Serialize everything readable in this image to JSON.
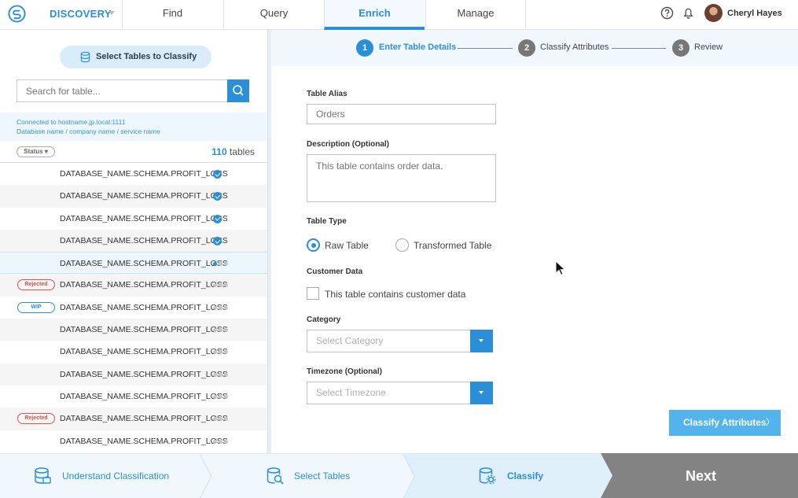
{
  "app": {
    "brand": "DISCOVERY",
    "user_name": "Cheryl Hayes",
    "tabs": [
      "Find",
      "Query",
      "Enrich",
      "Manage"
    ],
    "active_tab": "Enrich",
    "accent_color": "#2a8fd6"
  },
  "sidebar": {
    "select_button": "Select Tables to Classify",
    "search_placeholder": "Search for table...",
    "connection_line1": "Connected to hostname.jp.local:1111",
    "connection_line2": "Database name / company name / service name",
    "status_filter": "Status ▾",
    "table_count": "110",
    "table_count_label": "tables",
    "rows": [
      {
        "name": "DATABASE_NAME.SCHEMA.PROFIT_LOSS",
        "state": "done",
        "tag": ""
      },
      {
        "name": "DATABASE_NAME.SCHEMA.PROFIT_LOSS",
        "state": "done",
        "tag": ""
      },
      {
        "name": "DATABASE_NAME.SCHEMA.PROFIT_LOSS",
        "state": "done",
        "tag": ""
      },
      {
        "name": "DATABASE_NAME.SCHEMA.PROFIT_LOSS",
        "state": "done",
        "tag": ""
      },
      {
        "name": "DATABASE_NAME.SCHEMA.PROFIT_LOSS",
        "state": "in-progress",
        "tag": ""
      },
      {
        "name": "DATABASE_NAME.SCHEMA.PROFIT_LOSS",
        "state": "pending",
        "tag": "Rejected"
      },
      {
        "name": "DATABASE_NAME.SCHEMA.PROFIT_LOSS",
        "state": "pending",
        "tag": "WIP"
      },
      {
        "name": "DATABASE_NAME.SCHEMA.PROFIT_LOSS",
        "state": "pending",
        "tag": ""
      },
      {
        "name": "DATABASE_NAME.SCHEMA.PROFIT_LOSS",
        "state": "pending",
        "tag": ""
      },
      {
        "name": "DATABASE_NAME.SCHEMA.PROFIT_LOSS",
        "state": "pending",
        "tag": ""
      },
      {
        "name": "DATABASE_NAME.SCHEMA.PROFIT_LOSS",
        "state": "pending",
        "tag": ""
      },
      {
        "name": "DATABASE_NAME.SCHEMA.PROFIT_LOSS",
        "state": "pending",
        "tag": "Rejected"
      },
      {
        "name": "DATABASE_NAME.SCHEMA.PROFIT_LOSS",
        "state": "pending",
        "tag": ""
      }
    ]
  },
  "stepper": {
    "steps": [
      {
        "num": "1",
        "label": "Enter Table Details"
      },
      {
        "num": "2",
        "label": "Classify Attributes"
      },
      {
        "num": "3",
        "label": "Review"
      }
    ],
    "active_step": 1
  },
  "form": {
    "alias_label": "Table Alias",
    "alias_placeholder": "Orders",
    "description_label": "Description (Optional)",
    "description_placeholder": "This table contains order data.",
    "type_label": "Table Type",
    "type_options": [
      "Raw Table",
      "Transformed Table"
    ],
    "type_selected": "Raw Table",
    "customer_label": "Customer Data",
    "customer_checkbox_label": "This table contains customer data",
    "customer_checked": false,
    "category_label": "Category",
    "category_placeholder": "Select Category",
    "timezone_label": "Timezone (Optional)",
    "timezone_placeholder": "Select Timezone",
    "submit_label": "Classify Attributes",
    "submit_chevron": "〉"
  },
  "workflow": {
    "steps": [
      "Understand Classification",
      "Select Tables",
      "Classify"
    ],
    "active": "Classify",
    "next_label": "Next"
  }
}
